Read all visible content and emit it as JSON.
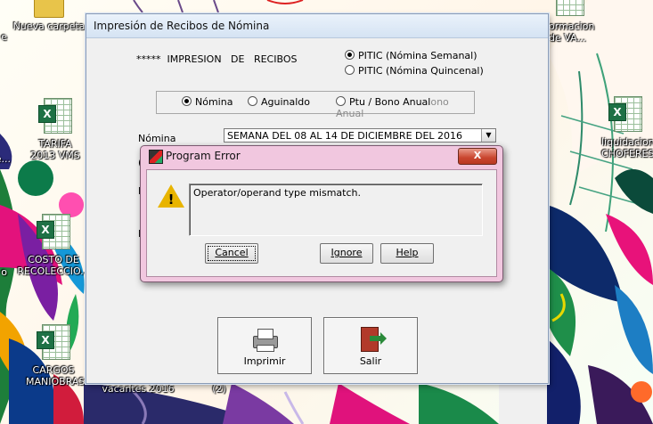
{
  "desktop": {
    "icons": [
      {
        "label": "Nueva carpeta",
        "type": "folder"
      },
      {
        "label": "TARIFA 2013 VMS",
        "type": "excel-file"
      },
      {
        "label": "COSTO DE RECOLECCIO...",
        "type": "excel-file"
      },
      {
        "label": "CARGOS MANIOBRAS",
        "type": "excel-file"
      },
      {
        "label": "ormacion de VA...",
        "type": "excel-file"
      },
      {
        "label": "liquidacion CHOFERES",
        "type": "excel-file"
      },
      {
        "label": "vacantes 2016",
        "type": "partial"
      },
      {
        "label": "(2)",
        "type": "partial"
      }
    ],
    "left_edge_fragments": [
      "e",
      "o",
      "e..."
    ]
  },
  "main_window": {
    "title": "Impresión  de  Recibos  de  Nómina",
    "heading": "*****  IMPRESION   DE   RECIBOS",
    "period_radios": [
      {
        "label": "PITIC (Nómina Semanal)",
        "selected": true
      },
      {
        "label": "PITIC (Nómina Quincenal)",
        "selected": false
      }
    ],
    "type_radios": [
      {
        "label": "Nómina",
        "selected": true
      },
      {
        "label": "Aguinaldo",
        "selected": false
      },
      {
        "label": "Ptu / Bono Anual",
        "selected": false
      }
    ],
    "type_ghost_text": "ono Anual",
    "nomina_label": "Nómina",
    "nomina_value": "SEMANA DEL 08 AL 14 DE DICIEMBRE DEL 2016",
    "partial_labels": [
      "(",
      "D",
      "P"
    ],
    "buttons": {
      "print": "Imprimir",
      "exit": "Salir"
    }
  },
  "error_dialog": {
    "title": "Program Error",
    "close_glyph": "X",
    "message": "Operator/operand type mismatch.",
    "buttons": {
      "cancel": "Cancel",
      "ignore": "Ignore",
      "help": "Help"
    },
    "accent": "#f1c7df"
  },
  "colors": {
    "close_red": "#c9452e",
    "excel_green": "#1e7145",
    "warning_yellow": "#e8b400"
  }
}
